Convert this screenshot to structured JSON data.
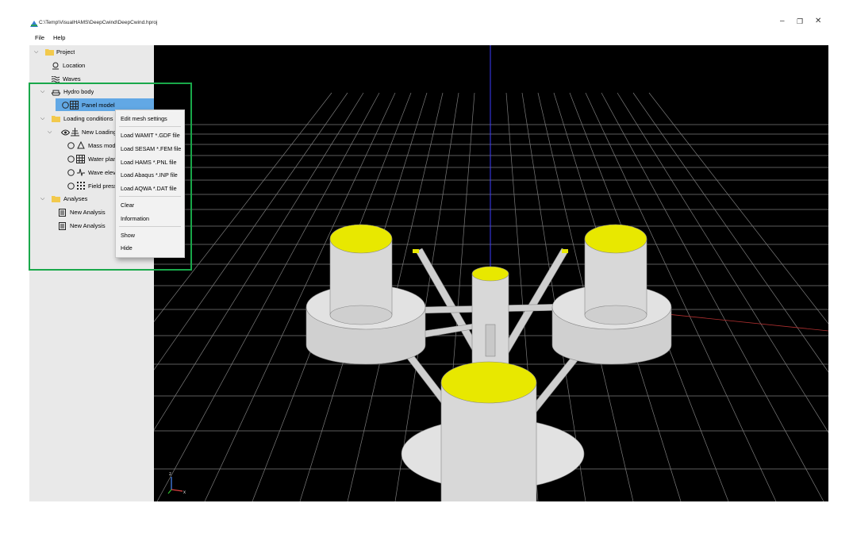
{
  "window": {
    "title": "C:\\Temp\\VisualHAMS\\DeepCwind\\DeepCwind.hproj",
    "minimize": "–",
    "restore": "❐",
    "close": "✕"
  },
  "menu": [
    "File",
    "Help"
  ],
  "tree": {
    "project": "Project",
    "location": "Location",
    "waves": "Waves",
    "hydro_body": "Hydro body",
    "panel_model": "Panel model",
    "loading_conditions": "Loading conditions",
    "new_loading": "New Loading",
    "mass_model": "Mass mod",
    "water_plane": "Water plan",
    "wave_elevation": "Wave elev",
    "field_pressure": "Field press",
    "analyses": "Analyses",
    "analysis_1": "New Analysis",
    "analysis_2": "New Analysis"
  },
  "context_menu": {
    "edit_mesh": "Edit mesh settings",
    "load_wamit": "Load WAMIT *.GDF file",
    "load_sesam": "Load SESAM *.FEM file",
    "load_hams": "Load HAMS *.PNL file",
    "load_abaqus": "Load Abaqus *.INP file",
    "load_aqwa": "Load AQWA *.DAT file",
    "clear": "Clear",
    "information": "Information",
    "show": "Show",
    "hide": "Hide"
  },
  "axes": {
    "z": "z",
    "x": "x",
    "y": "y"
  },
  "colors": {
    "selection": "#62a8e5",
    "highlight_box": "#19a84a",
    "viewport_bg": "#000000",
    "grid": "#8c8c8c",
    "mesh_face": "#d8d8d8",
    "column_top": "#e8e800"
  },
  "icons": {
    "folder": "folder-icon",
    "location": "location-pin-icon",
    "waves": "waves-icon",
    "ship": "ship-icon",
    "grid": "grid-icon",
    "eye": "eye-icon"
  }
}
